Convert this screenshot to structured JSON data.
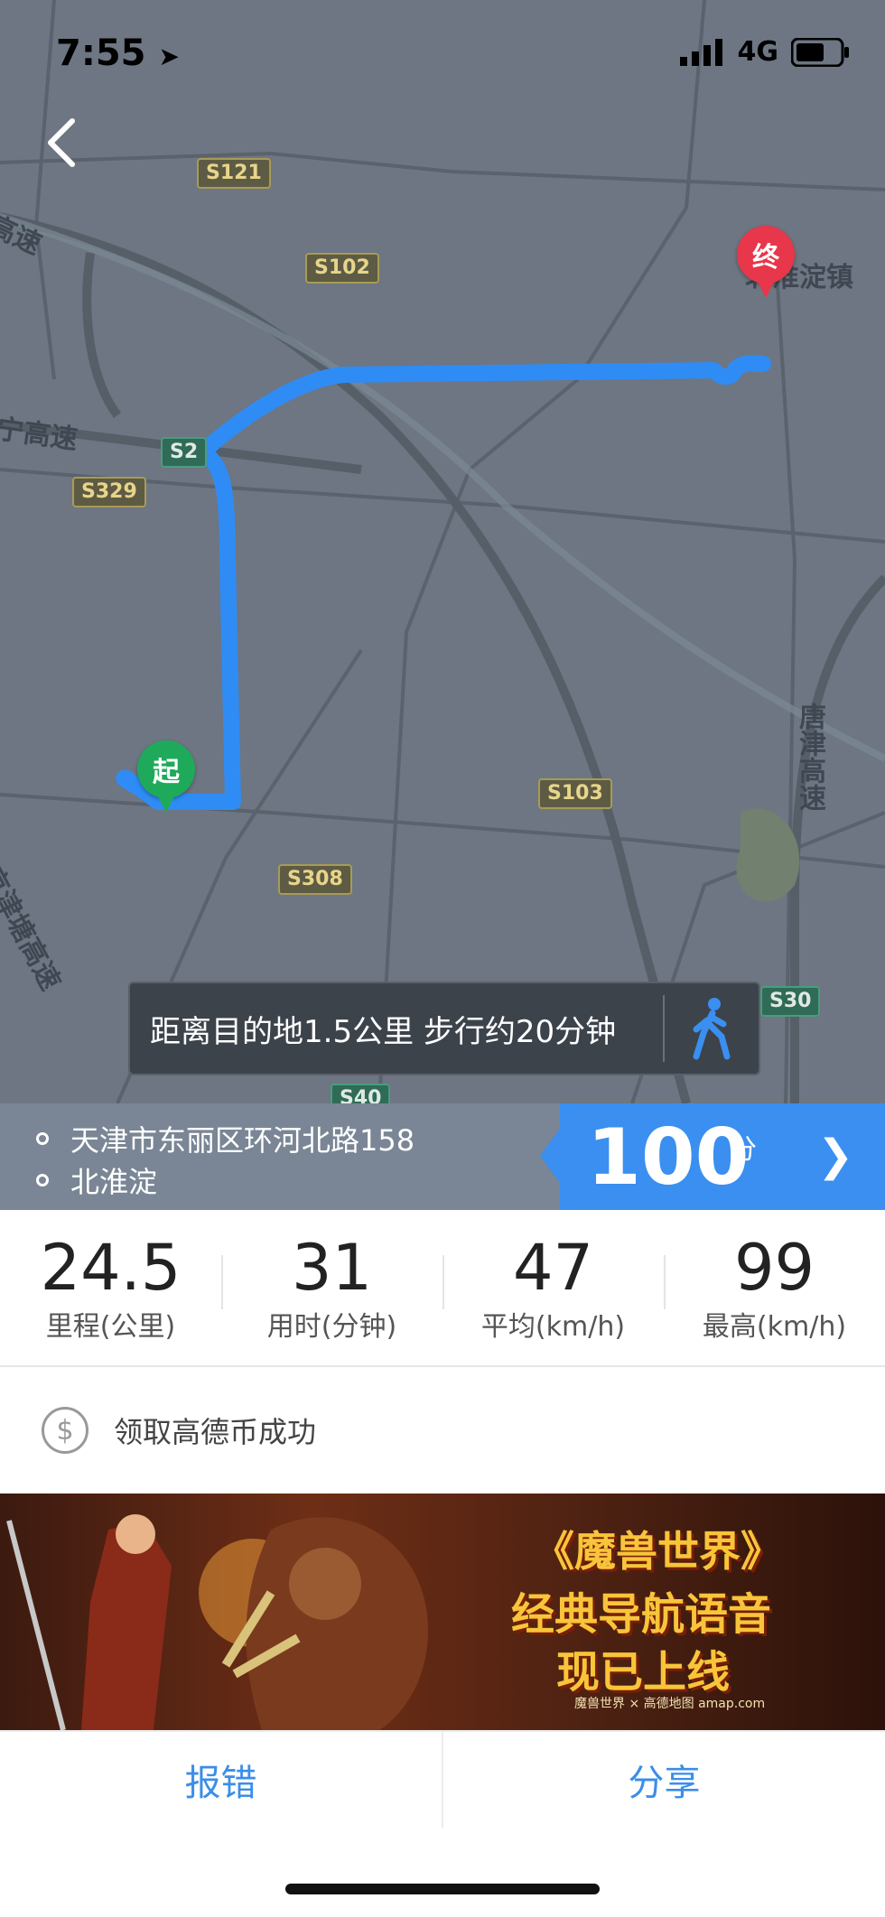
{
  "status_bar": {
    "time": "7:55",
    "network": "4G"
  },
  "map": {
    "road_shields": [
      "S121",
      "S102",
      "S2",
      "S329",
      "S103",
      "S308",
      "S30",
      "S40"
    ],
    "place_labels": {
      "destination_town": "北淮淀镇",
      "tangjin": "唐津高速",
      "jinghu": "高速",
      "ninggao": "宁高速",
      "jingjintang": "京津塘高速"
    },
    "start_pin": "起",
    "end_pin": "终",
    "distance_text": "距离目的地1.5公里 步行约20分钟",
    "route_color": "#2f8cf5"
  },
  "route": {
    "origin": "天津市东丽区环河北路158",
    "destination": "北淮淀",
    "score": "100",
    "score_unit": "分"
  },
  "stats": [
    {
      "value": "24.5",
      "label": "里程(公里)"
    },
    {
      "value": "31",
      "label": "用时(分钟)"
    },
    {
      "value": "47",
      "label": "平均(km/h)"
    },
    {
      "value": "99",
      "label": "最高(km/h)"
    }
  ],
  "coin": {
    "text": "领取高德币成功"
  },
  "banner": {
    "line1": "《魔兽世界》",
    "line2": "经典导航语音",
    "line3": "现已上线",
    "logos": "魔兽世界 × 高德地图 amap.com"
  },
  "footer": {
    "report": "报错",
    "share": "分享"
  }
}
